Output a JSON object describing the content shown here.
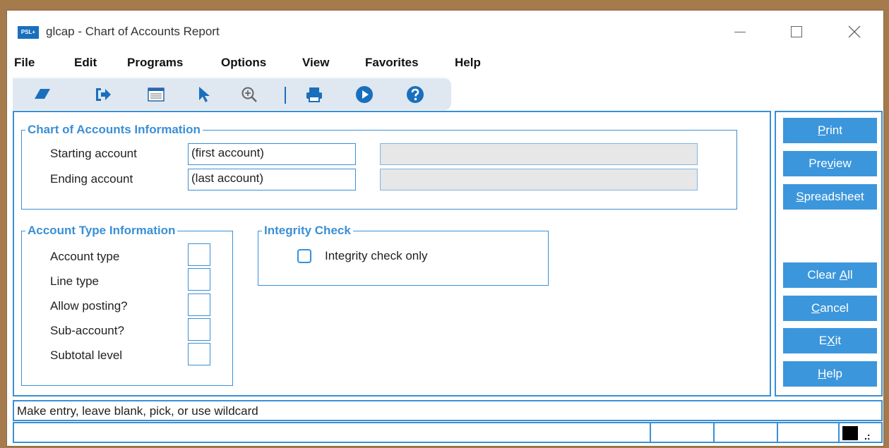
{
  "window": {
    "app_icon_text": "PSL+",
    "title": "glcap - Chart of Accounts Report",
    "buttons": {
      "minimize": "minimize-icon",
      "maximize": "maximize-icon",
      "close": "close-icon"
    }
  },
  "menu": [
    "File",
    "Edit",
    "Programs",
    "Options",
    "View",
    "Favorites",
    "Help"
  ],
  "toolbar": {
    "icons": [
      "eraser-icon",
      "exit-arrow-icon",
      "list-icon",
      "pointer-icon",
      "zoom-icon",
      "print-icon",
      "play-icon",
      "help-icon"
    ],
    "accent": "#1a6fbd"
  },
  "chart_of_accounts": {
    "title": "Chart of Accounts Information",
    "starting_label": "Starting account",
    "starting_value": "(first account)",
    "ending_label": "Ending account",
    "ending_value": "(last account)"
  },
  "account_type": {
    "title": "Account Type Information",
    "rows": [
      "Account type",
      "Line type",
      "Allow posting?",
      "Sub-account?",
      "Subtotal level"
    ]
  },
  "integrity": {
    "title": "Integrity Check",
    "checkbox_label": "Integrity check only",
    "checked": false
  },
  "side_buttons": {
    "print": {
      "pre": "",
      "key": "P",
      "post": "rint"
    },
    "preview": {
      "pre": "Pre",
      "key": "v",
      "post": "iew"
    },
    "spreadsheet": {
      "pre": "",
      "key": "S",
      "post": "preadsheet"
    },
    "clear_all": {
      "pre": "Clear ",
      "key": "A",
      "post": "ll"
    },
    "cancel": {
      "pre": "",
      "key": "C",
      "post": "ancel"
    },
    "exit": {
      "pre": "E",
      "key": "X",
      "post": "it"
    },
    "help": {
      "pre": "",
      "key": "H",
      "post": "elp"
    }
  },
  "status": {
    "message": "Make entry, leave blank, pick, or use wildcard",
    "grip": ".:"
  },
  "colors": {
    "accent": "#3a8fd6",
    "button": "#3c96dc",
    "frame": "#a57a4c"
  }
}
